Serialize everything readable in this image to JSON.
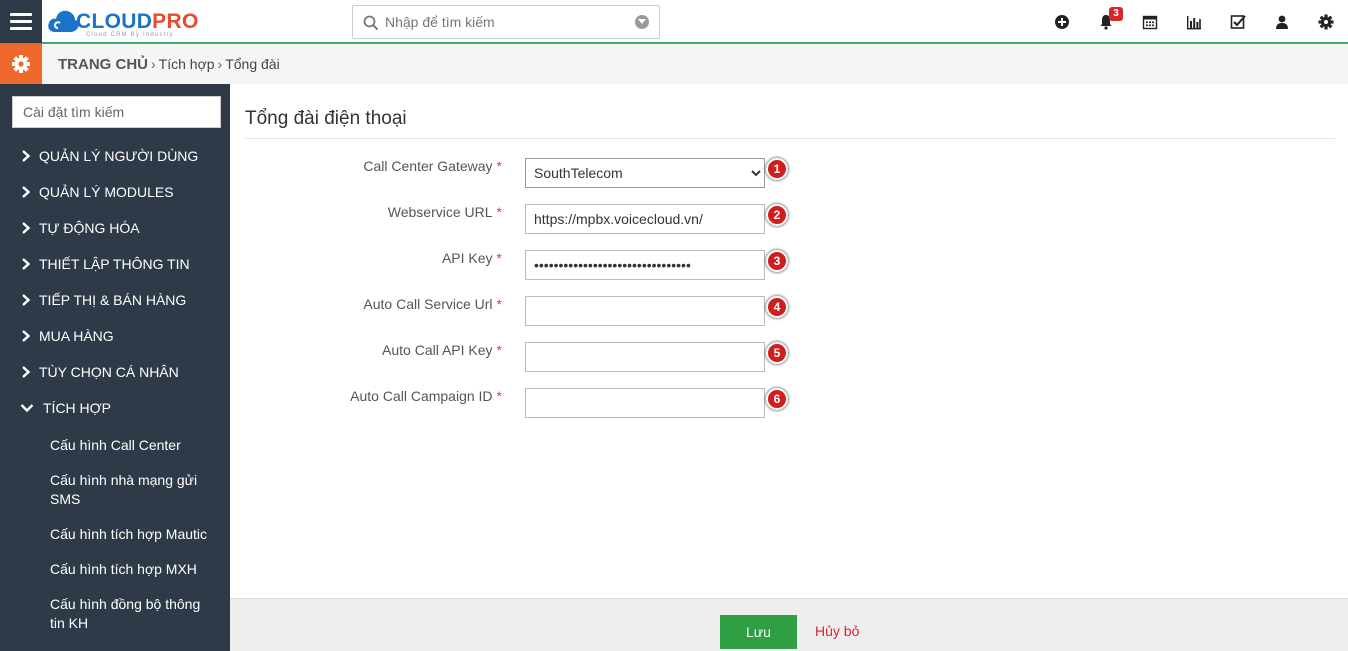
{
  "header": {
    "brand_part1": "CLOUD",
    "brand_part2": "PRO",
    "tagline": "Cloud CRM By Industry",
    "search_placeholder": "Nhập để tìm kiếm",
    "notification_count": "3",
    "icons": [
      "plus-circle-icon",
      "bell-icon",
      "calendar-icon",
      "bar-chart-icon",
      "checkbox-icon",
      "user-icon",
      "gear-icon"
    ]
  },
  "breadcrumb": {
    "home": "TRANG CHỦ",
    "level1": "Tích hợp",
    "level2": "Tổng đài"
  },
  "sidebar": {
    "filter_placeholder": "Cài đặt tìm kiếm",
    "items": [
      {
        "label": "QUẢN LÝ NGƯỜI DÙNG"
      },
      {
        "label": "QUẢN LÝ MODULES"
      },
      {
        "label": "TỰ ĐỘNG HÓA"
      },
      {
        "label": "THIẾT LẬP THÔNG TIN"
      },
      {
        "label": "TIẾP THỊ & BÁN HÀNG"
      },
      {
        "label": "MUA HÀNG"
      },
      {
        "label": "TÙY CHỌN CÁ NHÂN"
      },
      {
        "label": "TÍCH HỢP"
      }
    ],
    "subitems": [
      {
        "label": "Cấu hình Call Center"
      },
      {
        "label": "Cấu hình nhà mạng gửi SMS"
      },
      {
        "label": "Cấu hình tích hợp Mautic"
      },
      {
        "label": "Cấu hình tích hợp MXH"
      },
      {
        "label": "Cấu hình đồng bộ thông tin KH"
      }
    ]
  },
  "form": {
    "title": "Tổng đài điện thoại",
    "required_mark": "*",
    "fields": [
      {
        "label": "Call Center Gateway",
        "value": "SouthTelecom",
        "badge": "1"
      },
      {
        "label": "Webservice URL",
        "value": "https://mpbx.voicecloud.vn/",
        "badge": "2"
      },
      {
        "label": "API Key",
        "value": "••••••••••••••••••••••••••••••••",
        "badge": "3"
      },
      {
        "label": "Auto Call Service Url",
        "value": "",
        "badge": "4"
      },
      {
        "label": "Auto Call API Key",
        "value": "",
        "badge": "5"
      },
      {
        "label": "Auto Call Campaign ID",
        "value": "",
        "badge": "6"
      }
    ]
  },
  "footer": {
    "save_label": "Lưu",
    "cancel_label": "Hủy bỏ"
  },
  "colors": {
    "sidebar_bg": "#2e3a48",
    "accent_orange": "#f0682c",
    "save_green": "#2ea043",
    "cancel_red": "#d9262e",
    "badge_red": "#d11d1d"
  }
}
